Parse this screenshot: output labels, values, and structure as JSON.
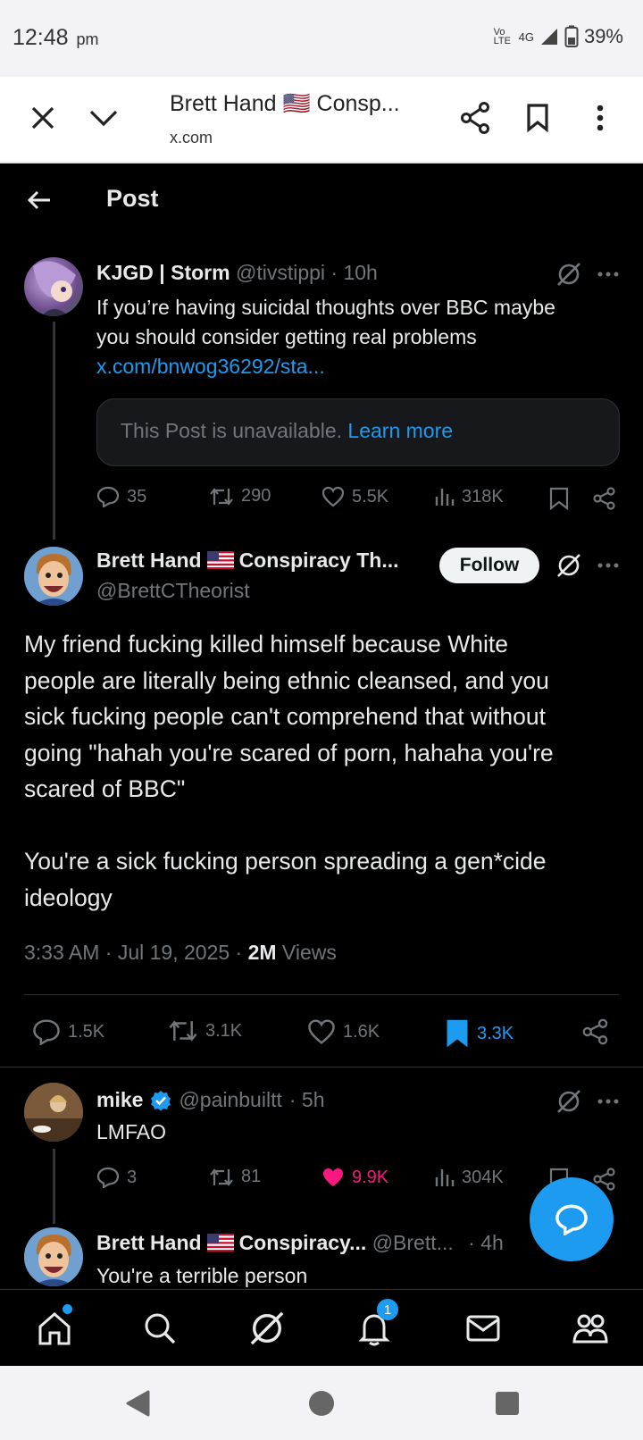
{
  "status_bar": {
    "time": "12:48",
    "ampm": "pm",
    "volte": "Vo\nLTE",
    "network": "4G",
    "battery": "39%"
  },
  "custom_tab": {
    "title": "Brett Hand 🇺🇸 Consp...",
    "url": "x.com"
  },
  "header": {
    "title": "Post"
  },
  "quoted_reply": {
    "name": "KJGD | Storm",
    "handle": "@tivstippi",
    "time": "· 10h",
    "text_line1": "If you’re having suicidal thoughts over BBC maybe",
    "text_line2": "you should consider getting real problems",
    "link": "x.com/bnwog36292/sta...",
    "unavailable_text": "This Post is unavailable.",
    "learn_more": "Learn more",
    "replies": "35",
    "reposts": "290",
    "likes": "5.5K",
    "views": "318K"
  },
  "main_post": {
    "name_prefix": "Brett Hand",
    "name_suffix": "Conspiracy Th...",
    "handle": "@BrettCTheorist",
    "follow_label": "Follow",
    "body_line1": "My friend fucking killed himself because White",
    "body_line2": "people are literally being ethnic cleansed, and you",
    "body_line3": "sick fucking people can't comprehend that without",
    "body_line4": "going \"hahah you're scared of porn, hahaha you're",
    "body_line5": "scared of BBC\"",
    "body_line6": "You're a sick fucking person spreading a gen*cide",
    "body_line7": "ideology",
    "timestamp": "3:33 AM · Jul 19, 2025 · ",
    "views_count": "2M",
    "views_label": " Views",
    "replies": "1.5K",
    "reposts": "3.1K",
    "likes": "1.6K",
    "bookmarks": "3.3K"
  },
  "reply1": {
    "name": "mike",
    "handle": "@painbuiltt",
    "time": "· 5h",
    "text": "LMFAO",
    "replies": "3",
    "reposts": "81",
    "likes": "9.9K",
    "views": "304K"
  },
  "reply2": {
    "name_prefix": "Brett Hand",
    "name_suffix": "Conspiracy...",
    "handle": "@Brett...",
    "time": "· 4h",
    "text": "You're a terrible person"
  },
  "bottom_nav": {
    "notification_count": "1"
  },
  "colors": {
    "accent": "#1d9bf0",
    "like": "#f91880",
    "bg": "#000000"
  }
}
